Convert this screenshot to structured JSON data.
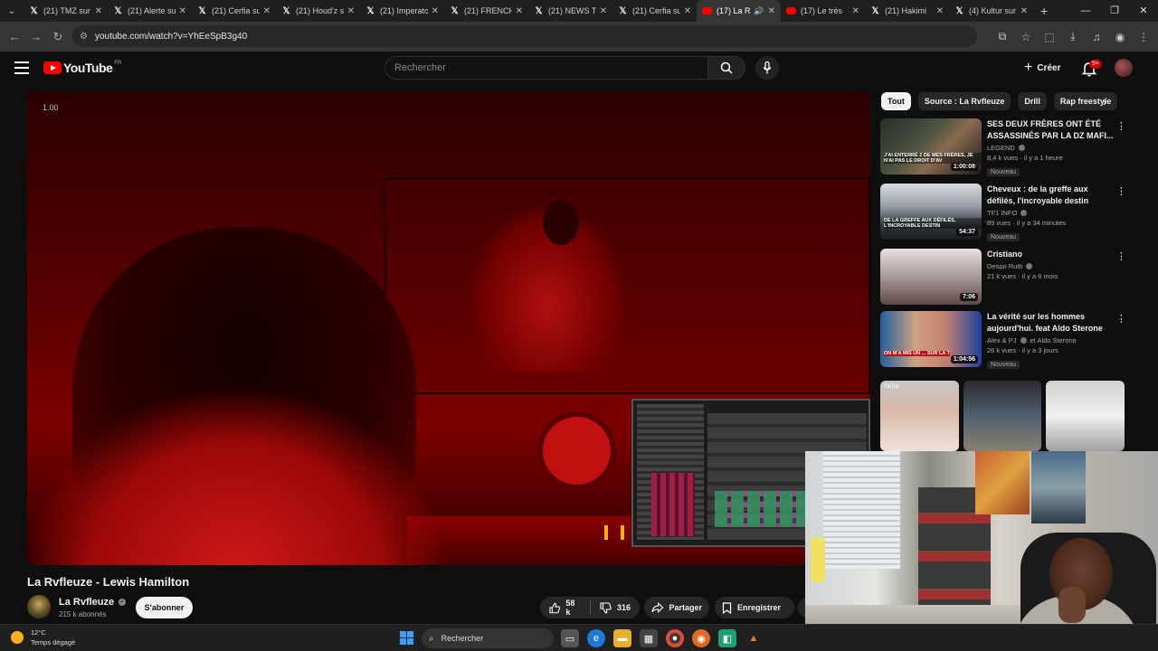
{
  "browser": {
    "tabs": [
      {
        "title": "(21) TMZ sur X",
        "favicon": "x-icon",
        "active": false
      },
      {
        "title": "(21) Alerte sur X",
        "favicon": "x-icon",
        "active": false
      },
      {
        "title": "(21) Cerfia sur X",
        "favicon": "x-icon",
        "active": false
      },
      {
        "title": "(21) Houd'z sur X",
        "favicon": "x-icon",
        "active": false
      },
      {
        "title": "(21) Imperator sur X",
        "favicon": "x-icon",
        "active": false
      },
      {
        "title": "(21) FRENCH sur X",
        "favicon": "x-icon",
        "active": false
      },
      {
        "title": "(21) NEWS T sur X",
        "favicon": "x-icon",
        "active": false
      },
      {
        "title": "(21) Cerfia sur X",
        "favicon": "x-icon",
        "active": false
      },
      {
        "title": "(17) La R",
        "favicon": "youtube-icon",
        "active": true
      },
      {
        "title": "(17) Le très",
        "favicon": "youtube-icon",
        "active": false
      },
      {
        "title": "(21) Hakimi",
        "favicon": "x-icon",
        "active": false
      },
      {
        "title": "(4) Kultur sur",
        "favicon": "x-icon",
        "active": false
      }
    ],
    "url": "youtube.com/watch?v=YhEeSpB3g40",
    "win_min": "—",
    "win_max": "❐",
    "win_close": "✕"
  },
  "youtube": {
    "logo_text": "YouTube",
    "region": "FR",
    "search_placeholder": "Rechercher",
    "create_label": "Créer",
    "notif_badge": "9+",
    "player": {
      "speed": "1.00"
    },
    "video_title": "La Rvfleuze - Lewis Hamilton",
    "channel": {
      "name": "La Rvfleuze",
      "subscribers": "215 k abonnés",
      "subscribe_label": "S'abonner"
    },
    "actions": {
      "likes": "58 k",
      "dislikes": "316",
      "share": "Partager",
      "save": "Enregistrer"
    },
    "chips": [
      "Tout",
      "Source : La Rvfleuze",
      "Drill",
      "Rap freestyle"
    ],
    "recommendations": [
      {
        "title": "SES DEUX FRÈRES ONT ÉTÉ ASSASSINÉS PAR LA DZ MAFI...",
        "channel": "LEGEND",
        "meta": "8,4 k vues · il y a 1 heure",
        "duration": "1:00:08",
        "badge": "Nouveau",
        "thumb_caption": "J'AI ENTERRÉ 2 DE MES FRÈRES, JE N'AI PAS LE DROIT D'AV"
      },
      {
        "title": "Cheveux : de la greffe aux défilés, l'incroyable destin d'un...",
        "channel": "TF1 INFO",
        "meta": "89 vues · il y a 34 minutes",
        "duration": "54:37",
        "badge": "Nouveau",
        "thumb_caption": "DE LA GREFFE AUX DÉFILÉS, L'INCROYABLE DESTIN"
      },
      {
        "title": "Cristiano",
        "channel": "Despo Rutti",
        "meta": "21 k vues · il y a 6 mois",
        "duration": "7:06",
        "badge": "",
        "thumb_caption": ""
      },
      {
        "title": "La vérité sur les hommes aujourd'hui. feat Aldo Sterone",
        "channel": "Alex & PJ",
        "channel_extra": "et Aldo Sterone",
        "meta": "26 k vues · il y a 3 jours",
        "duration": "1:04:56",
        "badge": "Nouveau",
        "thumb_caption": "ON M'A MIS UN ... SUR LA T"
      }
    ],
    "shorts": [
      "TikTok",
      "",
      ""
    ]
  },
  "taskbar": {
    "temperature": "12°C",
    "weather": "Temps dégagé",
    "search_label": "Rechercher"
  },
  "colors": {
    "brand_red": "#ff0000",
    "background": "#0f0f0f"
  }
}
